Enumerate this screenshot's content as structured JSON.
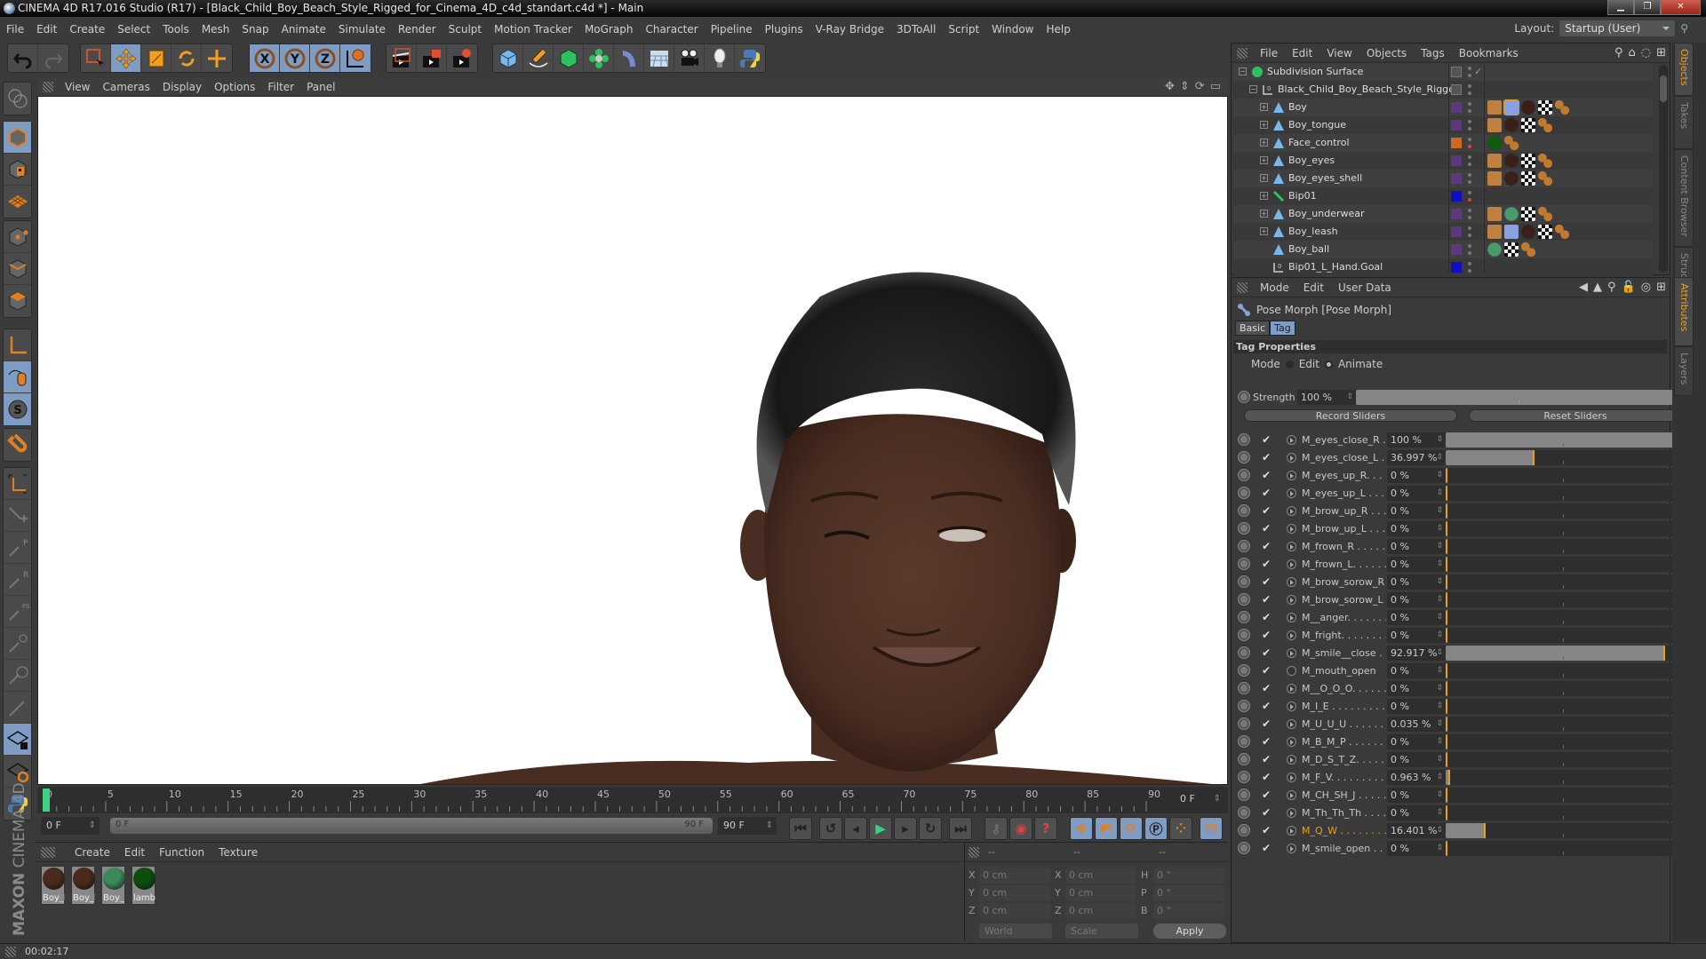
{
  "window": {
    "title": "CINEMA 4D R17.016 Studio (R17) - [Black_Child_Boy_Beach_Style_Rigged_for_Cinema_4D_c4d_standart.c4d *] - Main",
    "controls": [
      "minimize",
      "restore",
      "close"
    ]
  },
  "menu": [
    "File",
    "Edit",
    "Create",
    "Select",
    "Tools",
    "Mesh",
    "Snap",
    "Animate",
    "Simulate",
    "Render",
    "Sculpt",
    "Motion Tracker",
    "MoGraph",
    "Character",
    "Pipeline",
    "Plugins",
    "V-Ray Bridge",
    "3DToAll",
    "Script",
    "Window",
    "Help"
  ],
  "layout": {
    "label": "Layout:",
    "value": "Startup (User)"
  },
  "toolbar_icons": {
    "history": [
      "undo-icon",
      "redo-icon"
    ],
    "selection": [
      "live-selection-icon",
      "move-icon",
      "scale-icon",
      "rotate-icon",
      "last-tool-icon"
    ],
    "axis": [
      "x-axis-lock-icon",
      "y-axis-lock-icon",
      "z-axis-lock-icon",
      "world-coordinates-icon"
    ],
    "render": [
      "render-view-icon",
      "render-to-picture-viewer-icon",
      "render-settings-icon"
    ],
    "create": [
      "cube-icon",
      "pen-spline-icon",
      "subdivision-icon",
      "cloner-icon",
      "deformer-icon",
      "floor-icon",
      "camera-icon",
      "light-icon",
      "python-icon"
    ]
  },
  "left_tools": [
    "workplane-icon",
    "model-mode-icon",
    "texture-mode-icon",
    "workplane-grid-icon",
    "points-mode-icon",
    "edges-mode-icon",
    "polygons-mode-icon",
    "axis-mode-icon",
    "tweak-mode-icon",
    "soft-selection-icon",
    "snap-icon",
    "axis-enable-icon",
    "add-joint-icon",
    "joint-p-icon",
    "joint-r-icon",
    "joint-psr-icon",
    "joint-target-icon",
    "joint-param-icon",
    "joint-weight-icon",
    "locked-workplane-icon",
    "workplane-rotate-icon",
    "python-script-icon"
  ],
  "viewport": {
    "menu": [
      "View",
      "Cameras",
      "Display",
      "Options",
      "Filter",
      "Panel"
    ],
    "nav_icons": [
      "pan-icon",
      "zoom-icon",
      "rotate-view-icon",
      "maximize-view-icon"
    ]
  },
  "timeline": {
    "ticks": [
      0,
      5,
      10,
      15,
      20,
      25,
      30,
      35,
      40,
      45,
      50,
      55,
      60,
      65,
      70,
      75,
      80,
      85,
      90
    ],
    "min": 0,
    "max": 90,
    "current_frame": 0,
    "current_frame_label": "0 F",
    "start_field": "0 F",
    "range_start": "0 F",
    "range_end": "90 F",
    "end_field": "90 F",
    "playback_icons": [
      "go-to-start-icon",
      "previous-key-icon",
      "step-back-icon",
      "play-icon",
      "step-forward-icon",
      "next-key-icon",
      "go-to-end-icon"
    ],
    "key_icons": [
      "keyframe-selection-icon",
      "record-active-icon",
      "autokey-icon",
      "key-position-icon",
      "key-scale-icon",
      "key-rotation-icon",
      "key-parameter-icon",
      "key-pla-icon",
      "timeline-icon"
    ]
  },
  "materials": {
    "menu": [
      "Create",
      "Edit",
      "Function",
      "Texture"
    ],
    "items": [
      {
        "label": "Boy_l",
        "color": "#4a2a1c"
      },
      {
        "label": "Boy_l",
        "color": "#4a2a1c"
      },
      {
        "label": "Boy_",
        "color": "#3c8a5a"
      },
      {
        "label": "lamb",
        "color": "#0d4d0d"
      }
    ]
  },
  "branding": {
    "maxon": "MAXON",
    "product": "CINEMA 4D"
  },
  "coordinates": {
    "headers": [
      "--",
      "--",
      "--"
    ],
    "position": {
      "X": "0 cm",
      "Y": "0 cm",
      "Z": "0 cm"
    },
    "size": {
      "X": "0 cm",
      "Y": "0 cm",
      "Z": "0 cm"
    },
    "rotation": {
      "H": "0 °",
      "P": "0 °",
      "B": "0 °"
    },
    "space_dropdown": "World",
    "mode_dropdown": "Scale",
    "apply_label": "Apply"
  },
  "status": {
    "time": "00:02:17"
  },
  "object_manager": {
    "menu": [
      "File",
      "Edit",
      "View",
      "Objects",
      "Tags",
      "Bookmarks"
    ],
    "objects": [
      {
        "name": "Subdivision Surface",
        "indent": 0,
        "type": "subdivision",
        "layer_color": "",
        "tags": []
      },
      {
        "name": "Black_Child_Boy_Beach_Style_Rigged",
        "indent": 1,
        "type": "null",
        "layer_color": "",
        "tags": []
      },
      {
        "name": "Boy",
        "indent": 2,
        "type": "polygon",
        "layer_color": "#5a3a7a",
        "tags": [
          "phong",
          "pose-morph",
          "material-skin",
          "uvw",
          "weight"
        ]
      },
      {
        "name": "Boy_tongue",
        "indent": 2,
        "type": "polygon",
        "layer_color": "#5a3a7a",
        "tags": [
          "phong",
          "material-skin",
          "uvw",
          "weight"
        ]
      },
      {
        "name": "Face_control",
        "indent": 2,
        "type": "polygon",
        "layer_color": "#d06a20",
        "tags": [
          "material-green",
          "weight"
        ]
      },
      {
        "name": "Boy_eyes",
        "indent": 2,
        "type": "polygon",
        "layer_color": "#5a3a7a",
        "tags": [
          "phong",
          "material-skin",
          "uvw",
          "weight"
        ]
      },
      {
        "name": "Boy_eyes_shell",
        "indent": 2,
        "type": "polygon",
        "layer_color": "#5a3a7a",
        "tags": [
          "phong",
          "material-skin",
          "uvw",
          "weight"
        ]
      },
      {
        "name": "Bip01",
        "indent": 2,
        "type": "joint",
        "layer_color": "#1010c0",
        "tags": []
      },
      {
        "name": "Boy_underwear",
        "indent": 2,
        "type": "polygon",
        "layer_color": "#5a3a7a",
        "tags": [
          "phong",
          "material-cloth",
          "uvw",
          "weight"
        ]
      },
      {
        "name": "Boy_leash",
        "indent": 2,
        "type": "polygon",
        "layer_color": "#5a3a7a",
        "tags": [
          "phong",
          "pose-morph",
          "material-skin",
          "uvw",
          "weight"
        ]
      },
      {
        "name": "Boy_ball",
        "indent": 2,
        "type": "polygon",
        "layer_color": "#5a3a7a",
        "tags": [
          "material-cloth",
          "uvw",
          "weight"
        ]
      },
      {
        "name": "Bip01_L_Hand.Goal",
        "indent": 2,
        "type": "null",
        "layer_color": "#1010c0",
        "tags": []
      }
    ]
  },
  "attributes": {
    "menu": [
      "Mode",
      "Edit",
      "User Data"
    ],
    "object_title": "Pose Morph [Pose Morph]",
    "tabs": [
      {
        "label": "Basic",
        "active": false
      },
      {
        "label": "Tag",
        "active": true
      }
    ],
    "section": "Tag Properties",
    "mode_label": "Mode",
    "mode_options": [
      {
        "label": "Edit",
        "selected": false
      },
      {
        "label": "Animate",
        "selected": true
      }
    ],
    "strength_label": "Strength",
    "strength_value": "100 %",
    "strength_pct": 100,
    "record_label": "Record Sliders",
    "reset_label": "Reset Sliders",
    "morphs": [
      {
        "name": "M_eyes_close_R . .",
        "value": "100 %",
        "pct": 100
      },
      {
        "name": "M_eyes_close_L . .",
        "value": "36.997 %",
        "pct": 36.997
      },
      {
        "name": "M_eyes_up_R. . . .",
        "value": "0 %",
        "pct": 0
      },
      {
        "name": "M_eyes_up_L . . . .",
        "value": "0 %",
        "pct": 0
      },
      {
        "name": "M_brow_up_R . . .",
        "value": "0 %",
        "pct": 0
      },
      {
        "name": "M_brow_up_L . . .",
        "value": "0 %",
        "pct": 0
      },
      {
        "name": "M_frown_R . . . . . .",
        "value": "0 %",
        "pct": 0
      },
      {
        "name": "M_frown_L. . . . . . .",
        "value": "0 %",
        "pct": 0
      },
      {
        "name": "M_brow_sorow_R",
        "value": "0 %",
        "pct": 0
      },
      {
        "name": "M_brow_sorow_L",
        "value": "0 %",
        "pct": 0
      },
      {
        "name": "M__anger. . . . . . . .",
        "value": "0 %",
        "pct": 0
      },
      {
        "name": "M_fright. . . . . . . .",
        "value": "0 %",
        "pct": 0
      },
      {
        "name": "M_smile__close . .",
        "value": "92.917 %",
        "pct": 92.917
      },
      {
        "name": "M_mouth_open",
        "value": "0 %",
        "pct": 0,
        "circle_icon": true
      },
      {
        "name": "M__O_O_O. . . . . .",
        "value": "0 %",
        "pct": 0
      },
      {
        "name": "M_I_E . . . . . . . . . .",
        "value": "0 %",
        "pct": 0
      },
      {
        "name": "M_U_U_U . . . . . . .",
        "value": "0.035 %",
        "pct": 0.035
      },
      {
        "name": "M_B_M_P . . . . . . .",
        "value": "0 %",
        "pct": 0
      },
      {
        "name": "M_D_S_T_Z. . . . . .",
        "value": "0 %",
        "pct": 0
      },
      {
        "name": "M_F_V. . . . . . . . . .",
        "value": "0.963 %",
        "pct": 0.963
      },
      {
        "name": "M_CH_SH_J . . . . . .",
        "value": "0 %",
        "pct": 0
      },
      {
        "name": "M_Th_Th_Th . . . . .",
        "value": "0 %",
        "pct": 0
      },
      {
        "name": "M_Q_W . . . . . . . . .",
        "value": "16.401 %",
        "pct": 16.401,
        "highlight": true
      },
      {
        "name": "M_smile_open . . .",
        "value": "0 %",
        "pct": 0
      }
    ]
  },
  "side_tabs_top": [
    {
      "label": "Objects",
      "active": true
    },
    {
      "label": "Takes"
    },
    {
      "label": "Content Browser"
    },
    {
      "label": "Structure"
    }
  ],
  "side_tabs_bottom": [
    {
      "label": "Attributes",
      "active": true
    },
    {
      "label": "Layers"
    }
  ],
  "colors": {
    "accent": "#e8a020",
    "active_button": "#7f9cc4",
    "panel": "#3a3a3a"
  }
}
